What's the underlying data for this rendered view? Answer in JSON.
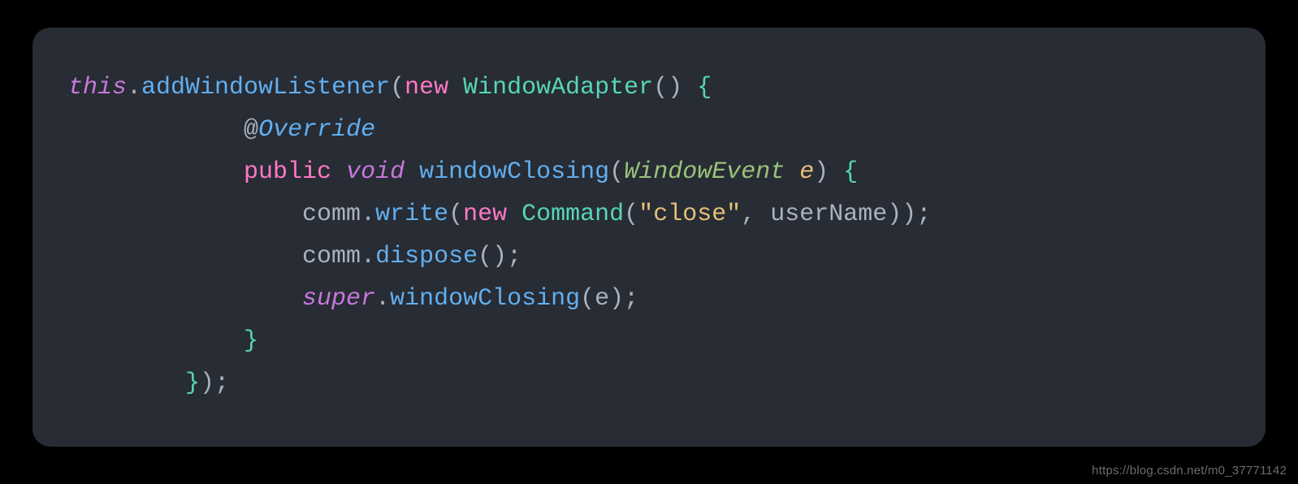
{
  "code": {
    "l1": {
      "this": "this",
      "dot1": ".",
      "fn": "addWindowListener",
      "lp": "(",
      "new": "new",
      "sp": " ",
      "type": "WindowAdapter",
      "pars": "()",
      "sp2": " ",
      "brace": "{"
    },
    "l2": {
      "indent": "            ",
      "at": "@",
      "anno": "Override"
    },
    "l3": {
      "indent": "            ",
      "kw": "public",
      "sp": " ",
      "void": "void",
      "sp2": " ",
      "fn": "windowClosing",
      "lp": "(",
      "ptype": "WindowEvent",
      "sp3": " ",
      "pe": "e",
      "rp": ")",
      "sp4": " ",
      "brace": "{"
    },
    "l4": {
      "indent": "                ",
      "obj": "comm",
      "dot": ".",
      "fn": "write",
      "lp": "(",
      "new": "new",
      "sp": " ",
      "type": "Command",
      "lp2": "(",
      "str": "\"close\"",
      "comma": ",",
      "sp2": " ",
      "arg": "userName",
      "rp2": ")",
      "rp": ")",
      "semi": ";"
    },
    "l5": {
      "indent": "                ",
      "obj": "comm",
      "dot": ".",
      "fn": "dispose",
      "pars": "()",
      "semi": ";"
    },
    "l6": {
      "indent": "                ",
      "super": "super",
      "dot": ".",
      "fn": "windowClosing",
      "lp": "(",
      "arg": "e",
      "rp": ")",
      "semi": ";"
    },
    "l7": {
      "indent": "            ",
      "brace": "}"
    },
    "l8": {
      "indent": "        ",
      "brace": "}",
      "rp": ")",
      "semi": ";"
    }
  },
  "watermark": "https://blog.csdn.net/m0_37771142"
}
